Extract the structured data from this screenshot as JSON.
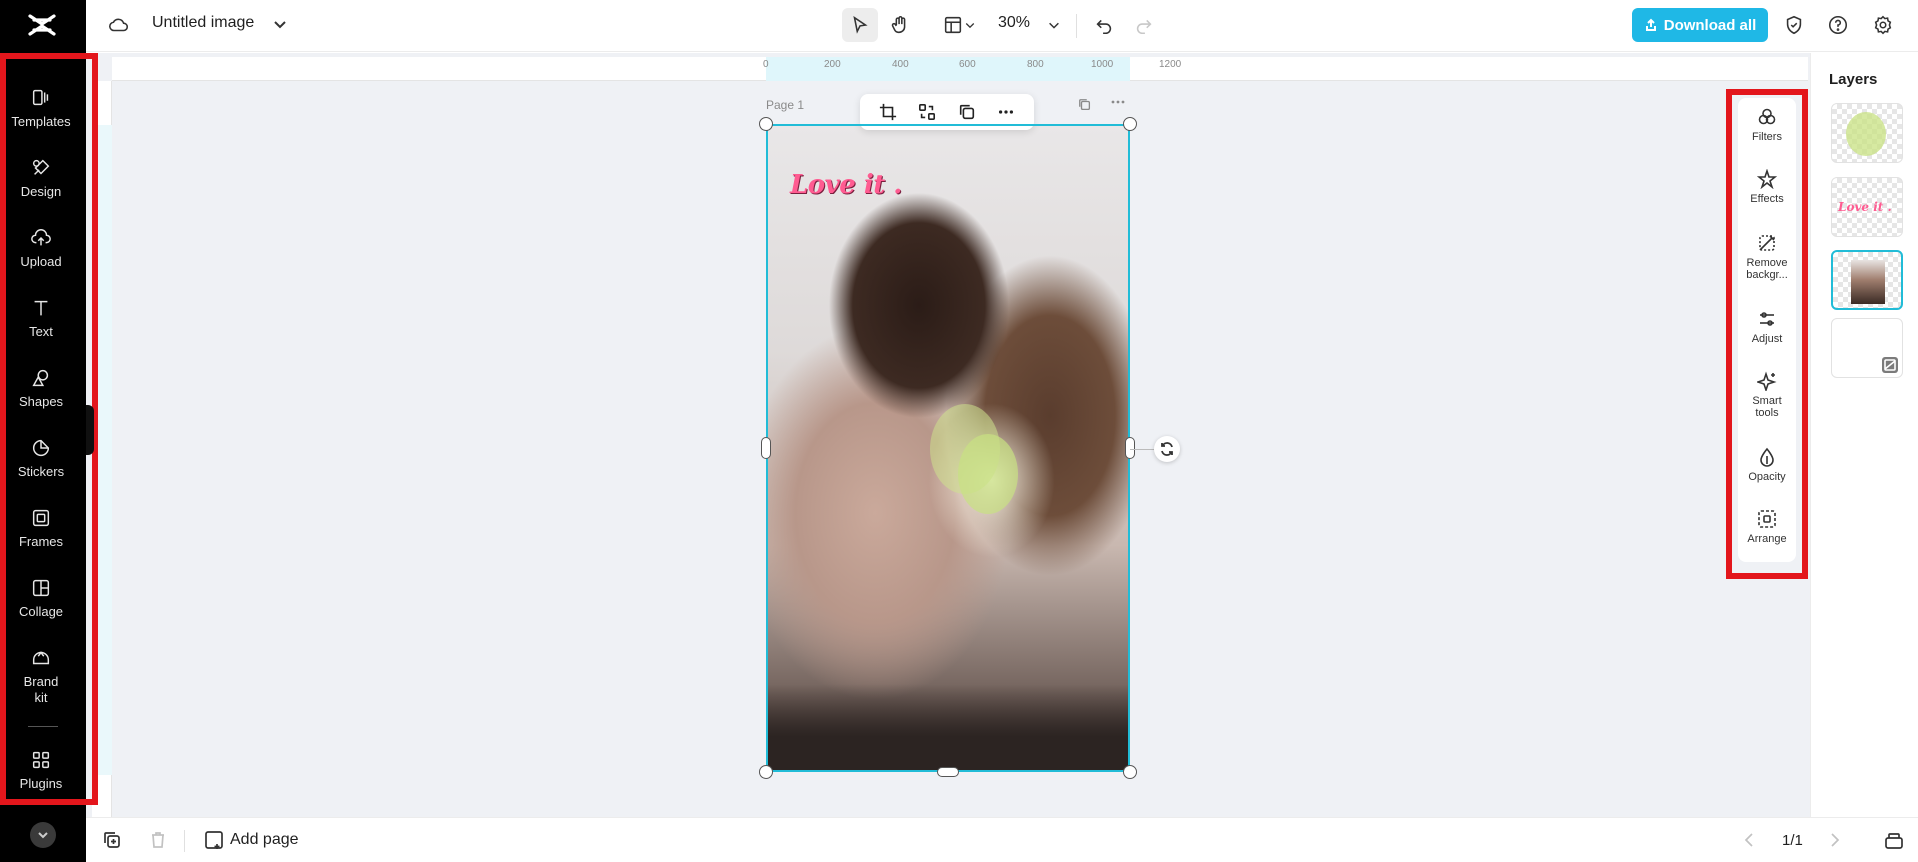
{
  "app": {
    "title": "Untitled image",
    "accent_color": "#1fb8e6",
    "selection_color": "#21bcd7",
    "highlight_color": "#e3161c"
  },
  "sidebar": {
    "items": [
      {
        "label": "Templates",
        "icon": "templates-icon"
      },
      {
        "label": "Design",
        "icon": "design-icon"
      },
      {
        "label": "Upload",
        "icon": "upload-icon"
      },
      {
        "label": "Text",
        "icon": "text-icon"
      },
      {
        "label": "Shapes",
        "icon": "shapes-icon"
      },
      {
        "label": "Stickers",
        "icon": "stickers-icon"
      },
      {
        "label": "Frames",
        "icon": "frames-icon"
      },
      {
        "label": "Collage",
        "icon": "collage-icon"
      },
      {
        "label": "Brand\nkit",
        "icon": "brand-kit-icon"
      },
      {
        "label": "Plugins",
        "icon": "plugins-icon"
      }
    ]
  },
  "toolbar": {
    "zoom": "30%",
    "download_label": "Download all"
  },
  "ruler": {
    "marks": [
      "0",
      "200",
      "400",
      "600",
      "800",
      "1000",
      "1200"
    ]
  },
  "canvas": {
    "page_label": "Page 1",
    "overlay_text": "Love it ."
  },
  "tools": {
    "items": [
      {
        "label": "Filters",
        "icon": "filters-icon"
      },
      {
        "label": "Effects",
        "icon": "effects-icon"
      },
      {
        "label": "Remove backgr...",
        "icon": "remove-background-icon"
      },
      {
        "label": "Adjust",
        "icon": "adjust-icon"
      },
      {
        "label": "Smart tools",
        "icon": "smart-tools-icon"
      },
      {
        "label": "Opacity",
        "icon": "opacity-icon"
      },
      {
        "label": "Arrange",
        "icon": "arrange-icon"
      }
    ]
  },
  "layers": {
    "title": "Layers",
    "thumb_text": "Love it ."
  },
  "bottom": {
    "add_page_label": "Add page",
    "page_count": "1/1"
  }
}
